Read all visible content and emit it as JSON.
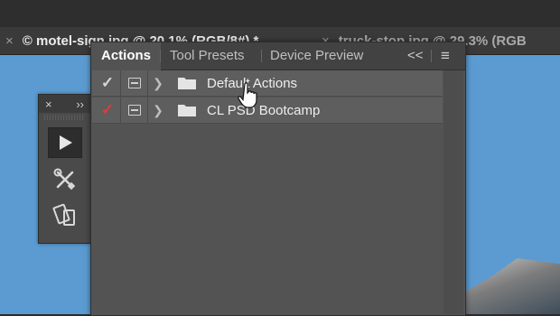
{
  "document_tabs": [
    {
      "close_label": "×",
      "title": "© motel-sign.jpg @ 20.1% (RGB/8#) *"
    },
    {
      "close_label": "×",
      "title": "truck-stop.jpg @ 29.3% (RGB"
    }
  ],
  "tools_panel": {
    "close_label": "×",
    "collapse_label": "››",
    "tools": [
      {
        "icon": "play-icon",
        "selected": true
      },
      {
        "icon": "tools-icon",
        "selected": false
      },
      {
        "icon": "device-preview-icon",
        "selected": false
      }
    ]
  },
  "actions_panel": {
    "tabs": [
      "Actions",
      "Tool Presets",
      "Device Preview"
    ],
    "collapse_label": "<<",
    "menu_label": "≡",
    "rows": [
      {
        "check": "✓",
        "check_color": "#d6d6d6",
        "label": "Default Actions",
        "hovered": true
      },
      {
        "check": "✓",
        "check_color": "#e23a3a",
        "label": "CL PSD Bootcamp",
        "hovered": false
      }
    ]
  },
  "colors": {
    "canvas": "#5b9bd1",
    "panel": "#535353",
    "row": "#5e5e5e",
    "accent_red": "#e23a3a"
  }
}
